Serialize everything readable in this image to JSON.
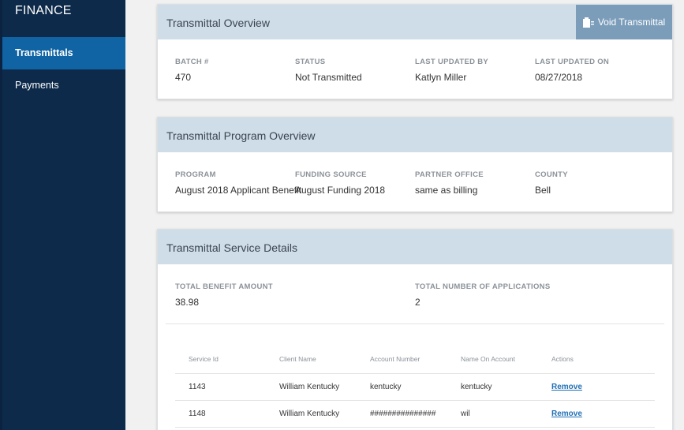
{
  "sidebar": {
    "title": "FINANCE",
    "items": [
      {
        "label": "Transmittals",
        "active": true
      },
      {
        "label": "Payments",
        "active": false
      }
    ]
  },
  "overview": {
    "title": "Transmittal Overview",
    "void_label": "Void Transmittal",
    "fields": [
      {
        "label": "BATCH #",
        "value": "470"
      },
      {
        "label": "STATUS",
        "value": "Not Transmitted"
      },
      {
        "label": "LAST UPDATED BY",
        "value": "Katlyn Miller"
      },
      {
        "label": "LAST UPDATED ON",
        "value": "08/27/2018"
      }
    ]
  },
  "program": {
    "title": "Transmittal Program Overview",
    "fields": [
      {
        "label": "PROGRAM",
        "value": "August 2018 Applicant Benefit"
      },
      {
        "label": "FUNDING SOURCE",
        "value": "August Funding 2018"
      },
      {
        "label": "PARTNER OFFICE",
        "value": "same as billing"
      },
      {
        "label": "COUNTY",
        "value": "Bell"
      }
    ]
  },
  "service": {
    "title": "Transmittal Service Details",
    "fields": [
      {
        "label": "TOTAL BENEFIT AMOUNT",
        "value": "38.98"
      },
      {
        "label": "TOTAL NUMBER OF APPLICATIONS",
        "value": "2"
      }
    ],
    "columns": [
      "Service Id",
      "Client Name",
      "Account Number",
      "Name On Account",
      "Actions"
    ],
    "rows": [
      {
        "service_id": "1143",
        "client_name": "William Kentucky",
        "account_number": "kentucky",
        "name_on_account": "kentucky",
        "action": "Remove"
      },
      {
        "service_id": "1148",
        "client_name": "William Kentucky",
        "account_number": "###############",
        "name_on_account": "wil",
        "action": "Remove"
      }
    ]
  }
}
